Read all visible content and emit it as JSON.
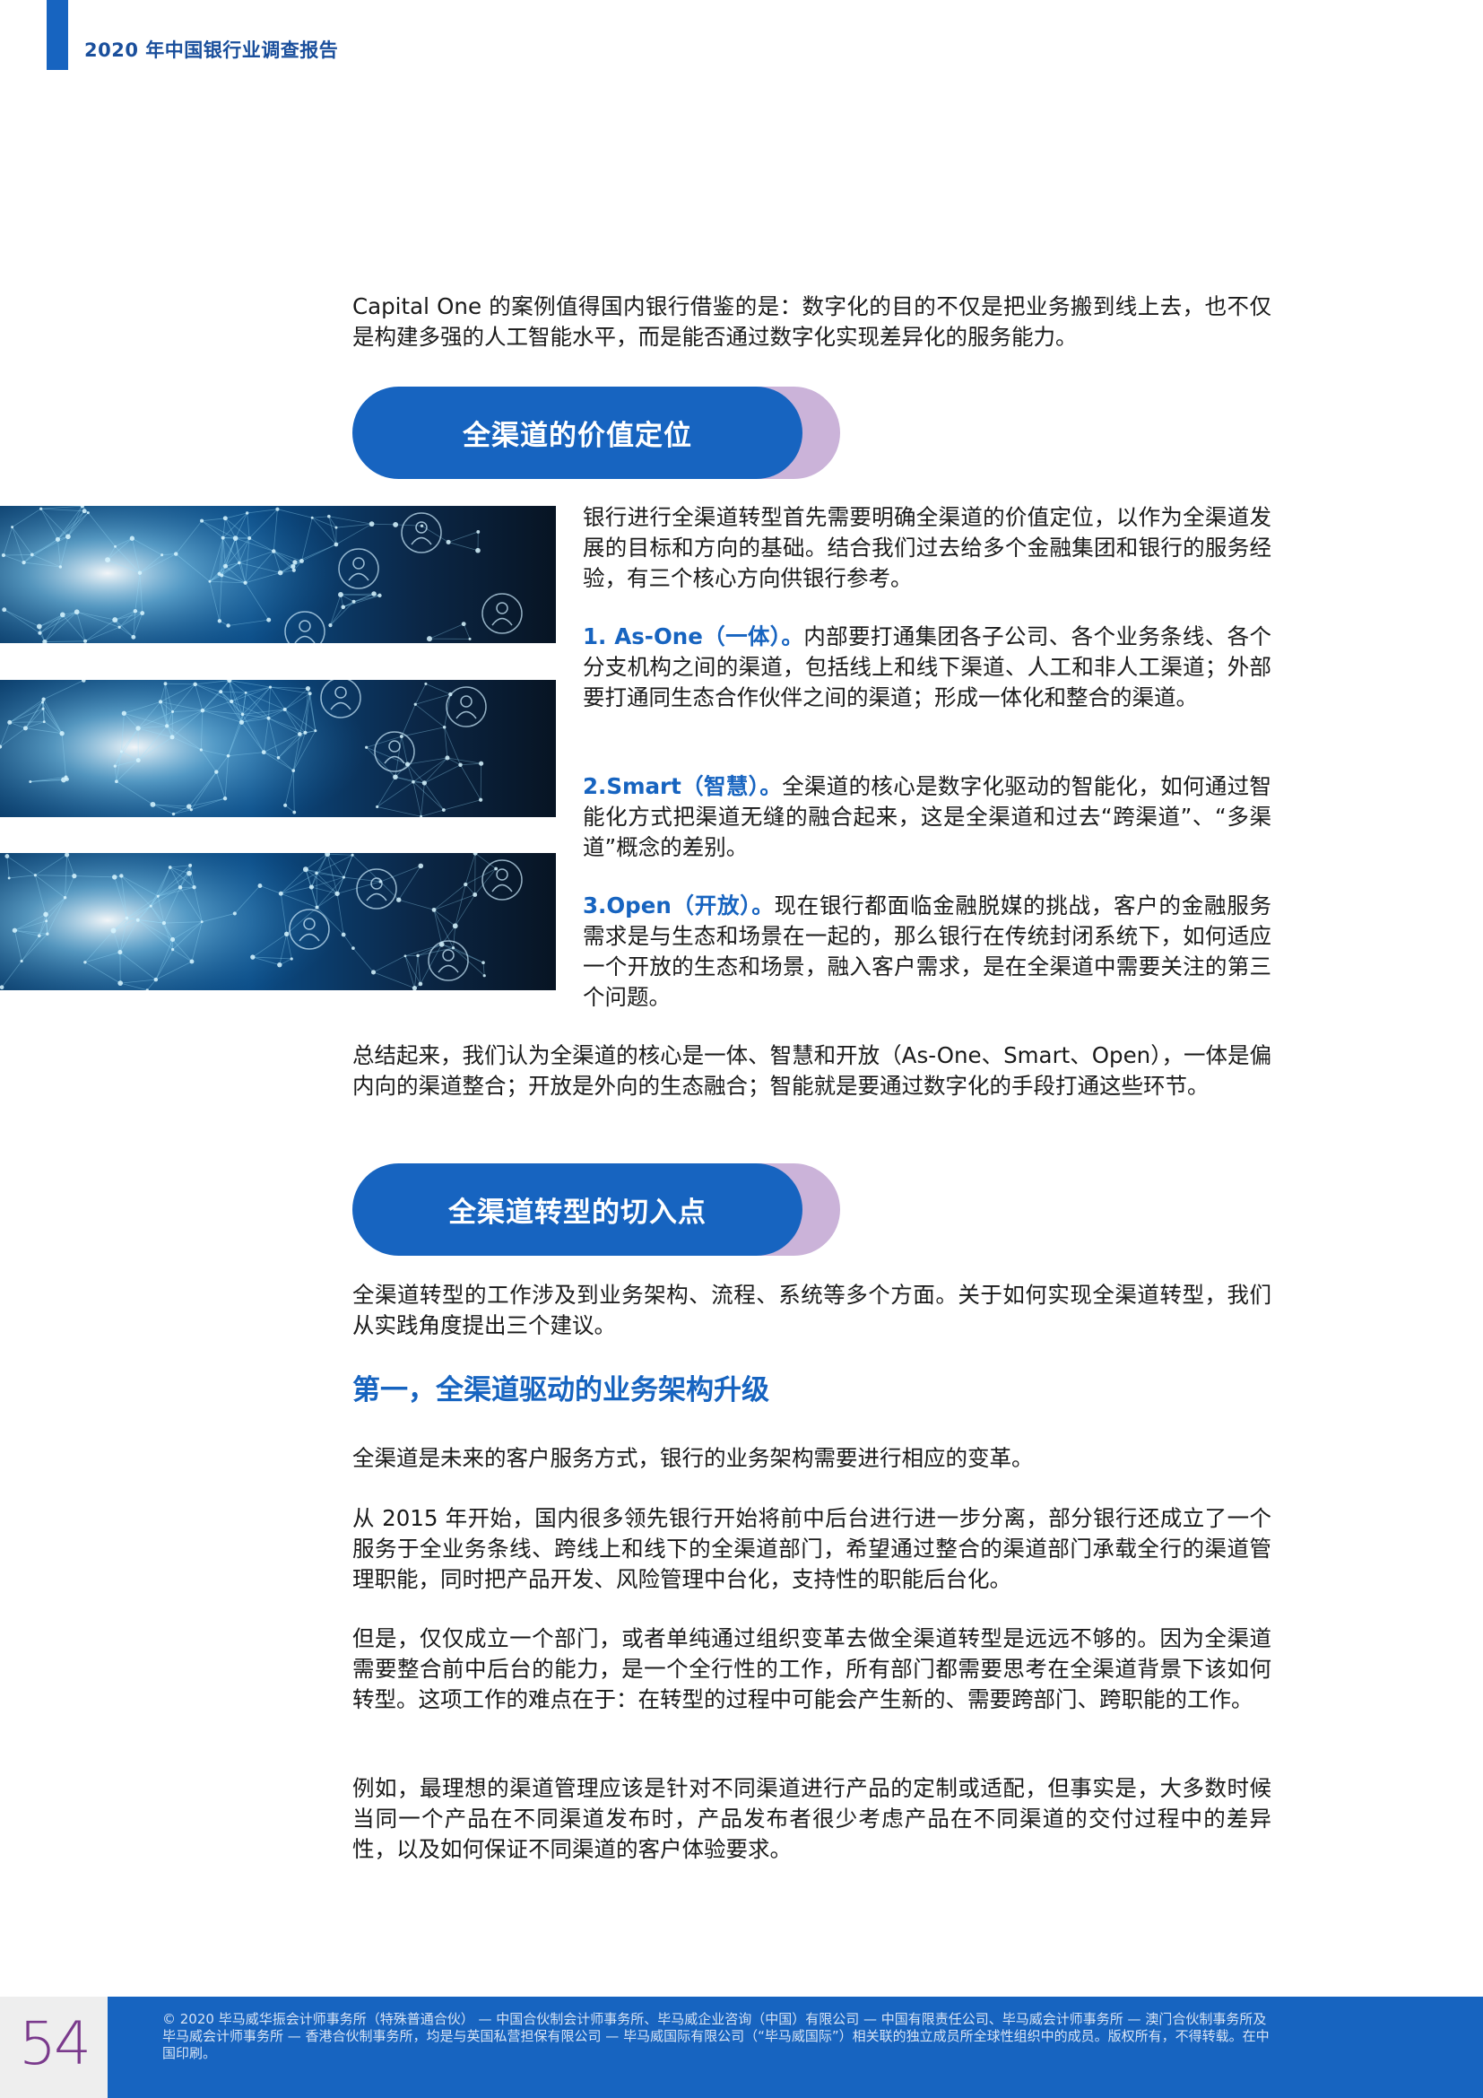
{
  "header": {
    "title": "2020 年中国银行业调查报告"
  },
  "intro": "Capital One 的案例值得国内银行借鉴的是：数字化的目的不仅是把业务搬到线上去，也不仅是构建多强的人工智能水平，而是能否通过数字化实现差异化的服务能力。",
  "section1": {
    "title": "全渠道的价值定位",
    "lead": "银行进行全渠道转型首先需要明确全渠道的价值定位，以作为全渠道发展的目标和方向的基础。结合我们过去给多个金融集团和银行的服务经验，有三个核心方向供银行参考。",
    "items": [
      {
        "label": "1. As-One（一体）。",
        "text": "内部要打通集团各子公司、各个业务条线、各个分支机构之间的渠道，包括线上和线下渠道、人工和非人工渠道；外部要打通同生态合作伙伴之间的渠道；形成一体化和整合的渠道。"
      },
      {
        "label": "2.Smart（智慧）。",
        "text": "全渠道的核心是数字化驱动的智能化，如何通过智能化方式把渠道无缝的融合起来，这是全渠道和过去“跨渠道”、“多渠道”概念的差别。"
      },
      {
        "label": "3.Open（开放）。",
        "text": "现在银行都面临金融脱媒的挑战，客户的金融服务需求是与生态和场景在一起的，那么银行在传统封闭系统下，如何适应一个开放的生态和场景，融入客户需求，是在全渠道中需要关注的第三个问题。"
      }
    ],
    "summary": "总结起来，我们认为全渠道的核心是一体、智慧和开放（As-One、Smart、Open），一体是偏内向的渠道整合；开放是外向的生态融合；智能就是要通过数字化的手段打通这些环节。"
  },
  "section2": {
    "title": "全渠道转型的切入点",
    "lead": "全渠道转型的工作涉及到业务架构、流程、系统等多个方面。关于如何实现全渠道转型，我们从实践角度提出三个建议。",
    "subhead": "第一，全渠道驱动的业务架构升级",
    "paragraphs": [
      "全渠道是未来的客户服务方式，银行的业务架构需要进行相应的变革。",
      "从 2015 年开始，国内很多领先银行开始将前中后台进行进一步分离，部分银行还成立了一个服务于全业务条线、跨线上和线下的全渠道部门，希望通过整合的渠道部门承载全行的渠道管理职能，同时把产品开发、风险管理中台化，支持性的职能后台化。",
      "但是，仅仅成立一个部门，或者单纯通过组织变革去做全渠道转型是远远不够的。因为全渠道需要整合前中后台的能力，是一个全行性的工作，所有部门都需要思考在全渠道背景下该如何转型。这项工作的难点在于：在转型的过程中可能会产生新的、需要跨部门、跨职能的工作。",
      "例如，最理想的渠道管理应该是针对不同渠道进行产品的定制或适配，但事实是，大多数时候当同一个产品在不同渠道发布时，产品发布者很少考虑产品在不同渠道的交付过程中的差异性，以及如何保证不同渠道的客户体验要求。"
    ]
  },
  "footer": {
    "page_number": "54",
    "copyright": "© 2020 毕马威华振会计师事务所（特殊普通合伙） — 中国合伙制会计师事务所、毕马威企业咨询（中国）有限公司 — 中国有限责任公司、毕马威会计师事务所 — 澳门合伙制事务所及毕马威会计师事务所 — 香港合伙制事务所，均是与英国私营担保有限公司 — 毕马威国际有限公司（“毕马威国际”）相关联的独立成员所全球性组织中的成员。版权所有，不得转载。在中国印刷。"
  },
  "colors": {
    "brand_blue": "#1764c0",
    "pill_accent": "#cbb3d9",
    "page_number": "#7a3a8c"
  },
  "images": [
    "network-globe-image",
    "network-globe-image",
    "network-globe-image"
  ]
}
